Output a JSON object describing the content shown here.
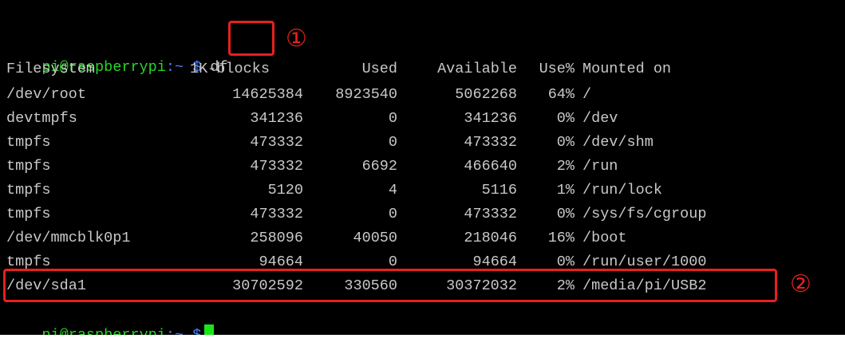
{
  "prompt": {
    "user_host": "pi@raspberrypi",
    "path": ":~",
    "dollar": "$"
  },
  "command": "df",
  "table": {
    "headers": [
      "Filesystem",
      "1K-blocks",
      "Used",
      "Available",
      "Use%",
      "Mounted on"
    ],
    "rows": [
      [
        "/dev/root",
        "14625384",
        "8923540",
        "5062268",
        "64%",
        "/"
      ],
      [
        "devtmpfs",
        "341236",
        "0",
        "341236",
        "0%",
        "/dev"
      ],
      [
        "tmpfs",
        "473332",
        "0",
        "473332",
        "0%",
        "/dev/shm"
      ],
      [
        "tmpfs",
        "473332",
        "6692",
        "466640",
        "2%",
        "/run"
      ],
      [
        "tmpfs",
        "5120",
        "4",
        "5116",
        "1%",
        "/run/lock"
      ],
      [
        "tmpfs",
        "473332",
        "0",
        "473332",
        "0%",
        "/sys/fs/cgroup"
      ],
      [
        "/dev/mmcblk0p1",
        "258096",
        "40050",
        "218046",
        "16%",
        "/boot"
      ],
      [
        "tmpfs",
        "94664",
        "0",
        "94664",
        "0%",
        "/run/user/1000"
      ],
      [
        "/dev/sda1",
        "30702592",
        "330560",
        "30372032",
        "2%",
        "/media/pi/USB2"
      ]
    ]
  },
  "annotations": {
    "marker_1": "①",
    "marker_2": "②"
  },
  "colors": {
    "background": "#000000",
    "text": "#c8c8c8",
    "prompt_user": "#26d626",
    "prompt_path": "#4a7ff5",
    "cursor": "#19e619",
    "annotation": "#e8201e"
  }
}
